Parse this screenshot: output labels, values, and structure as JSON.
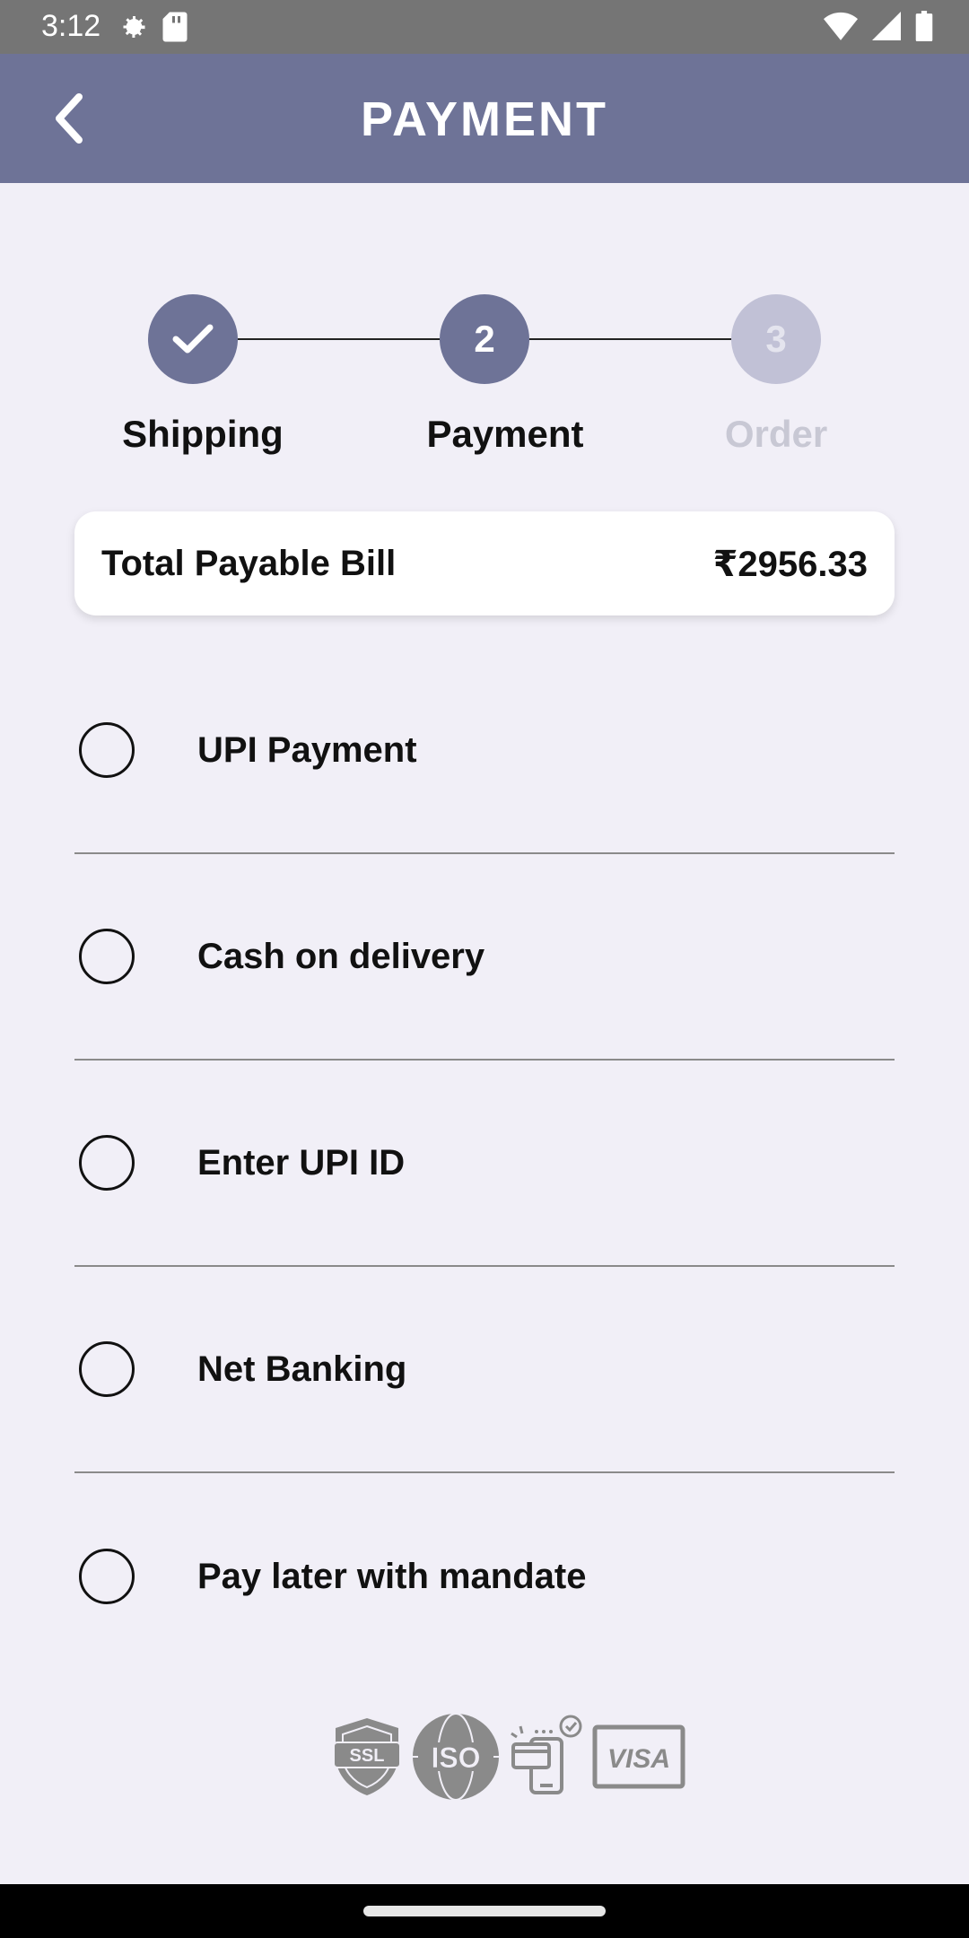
{
  "status_bar": {
    "time": "3:12",
    "left_icons": [
      "settings-icon",
      "sd-card-icon"
    ],
    "right_icons": [
      "wifi-icon",
      "signal-icon",
      "battery-icon"
    ]
  },
  "app_bar": {
    "title": "PAYMENT",
    "back_icon": "chevron-left-icon",
    "color": "#6e7397"
  },
  "stepper": {
    "steps": [
      {
        "label": "Shipping",
        "badge": "",
        "state": "completed",
        "icon": "check-icon"
      },
      {
        "label": "Payment",
        "badge": "2",
        "state": "active"
      },
      {
        "label": "Order",
        "badge": "3",
        "state": "upcoming"
      }
    ],
    "active_color": "#6e7397",
    "inactive_color": "#c1c1d6",
    "inactive_text_color": "#c8c8d4"
  },
  "bill": {
    "label": "Total Payable Bill",
    "amount": "₹2956.33"
  },
  "payment_options": [
    {
      "label": "UPI Payment"
    },
    {
      "label": "Cash on delivery"
    },
    {
      "label": "Enter UPI ID"
    },
    {
      "label": "Net Banking"
    },
    {
      "label": "Pay later with mandate"
    }
  ],
  "trust_badges": {
    "icons": [
      "ssl-shield-icon",
      "iso-badge-icon",
      "secure-card-payment-icon",
      "visa-logo-icon"
    ],
    "ssl_text": "SSL",
    "iso_text": "ISO",
    "visa_text": "VISA",
    "color": "#8a8a8a"
  }
}
